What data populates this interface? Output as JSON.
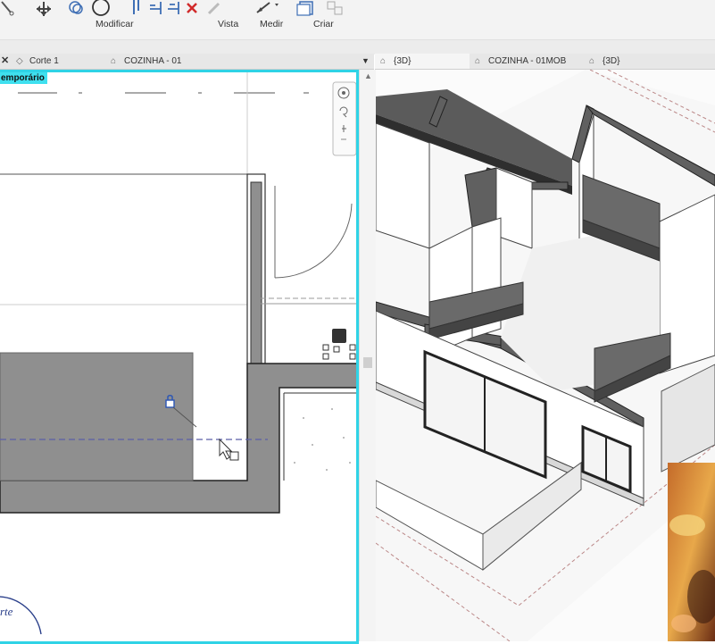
{
  "ribbon": {
    "groups": [
      {
        "label": "Modificar"
      },
      {
        "label": "Vista"
      },
      {
        "label": "Medir"
      },
      {
        "label": "Criar"
      }
    ]
  },
  "tabs_left": [
    {
      "label": "Corte 1",
      "icon": "section-view-icon"
    },
    {
      "label": "COZINHA - 01",
      "icon": "floor-plan-icon"
    }
  ],
  "tabs_right": [
    {
      "label": "{3D}",
      "icon": "3d-view-icon"
    },
    {
      "label": "COZINHA - 01MOB",
      "icon": "floor-plan-icon"
    },
    {
      "label": "{3D}",
      "icon": "3d-view-icon"
    }
  ],
  "left_view": {
    "temp_label": "emporário",
    "section_tag": "rte"
  },
  "colors": {
    "accent": "#2fd3e6",
    "wall_fill": "#8f8f8f",
    "section_line": "#5b5fa8"
  }
}
